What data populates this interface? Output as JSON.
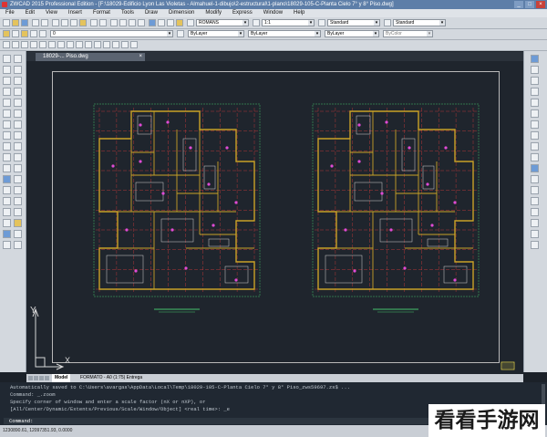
{
  "window": {
    "title": "ZWCAD 2015 Professional Edition - [F:\\18029-Edificio Lyon Las Violetas - Almahuel-1-dibujo\\2-estructural\\1-plano\\18029-105-C-Planta Cielo 7° y 8° Piso.dwg]",
    "controls": [
      "_",
      "□",
      "×"
    ]
  },
  "menu": [
    "File",
    "Edit",
    "View",
    "Insert",
    "Format",
    "Tools",
    "Draw",
    "Dimension",
    "Modify",
    "Express",
    "Window",
    "Help"
  ],
  "toolbar": {
    "text_style": "ROMANS",
    "dim_scale": "1:1",
    "dim_style": "Standard",
    "table_style": "Standard",
    "layer": "0",
    "color": "ByLayer",
    "linetype": "ByLayer",
    "lineweight": "ByLayer",
    "plotstyle": "ByColor"
  },
  "document": {
    "tab_label": "18029-... Piso.dwg",
    "tab_close": "×"
  },
  "canvas": {
    "ucs_x": "X",
    "ucs_y": "Y"
  },
  "layout_tabs": [
    "Model",
    "FORMATO - A0 (1:75) Entrega"
  ],
  "command": {
    "history": [
      "Automatically saved to C:\\Users\\avargas\\AppData\\Local\\Temp\\18029-105-C-Planta Cielo 7° y 8° Piso_zws59697.zs$ ...",
      "Command: _.zoom",
      "Specify corner of window and enter a scale factor (nX or nXP), or",
      "[All/Center/Dynamic/Extents/Previous/Scale/Window/Object] <real time>: _e"
    ],
    "prompt": "Command:"
  },
  "status": {
    "coordinates": "1230890.61, 12097351.93, 0.0000"
  },
  "watermark": "看看手游网",
  "colors": {
    "walls": "#c9a227",
    "grid": "#d63b3b",
    "dims": "#45c26d",
    "accent": "#5d7ea8"
  }
}
